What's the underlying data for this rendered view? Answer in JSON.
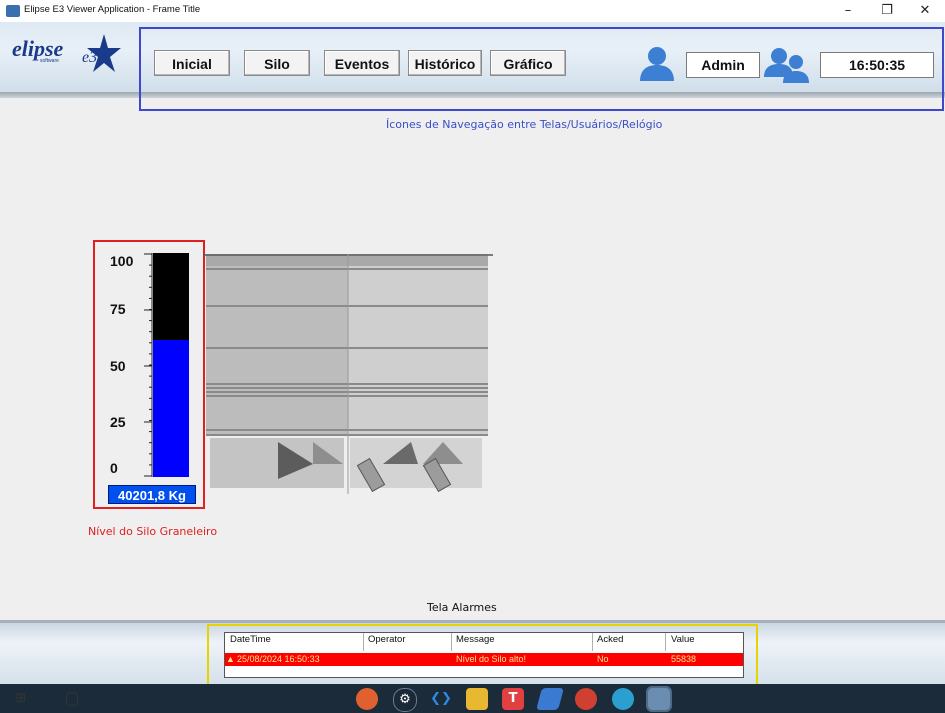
{
  "window": {
    "title": "Elipse E3 Viewer Application - Frame Title",
    "minimize_glyph": "–",
    "restore_glyph": "❐",
    "close_glyph": "✕"
  },
  "logo": {
    "word": "elipse",
    "sub": "software",
    "e3": "e3"
  },
  "nav": {
    "buttons": [
      "Inicial",
      "Silo",
      "Eventos",
      "Histórico",
      "Gráfico"
    ],
    "user": "Admin",
    "clock": "16:50:35",
    "caption": "Ícones de Navegação entre Telas/Usuários/Relógio"
  },
  "level": {
    "ticks": [
      "100",
      "75",
      "50",
      "25",
      "0"
    ],
    "fill_percent": 61,
    "weight": "40201,8 Kg",
    "caption": "Nível do Silo Graneleiro"
  },
  "alarms": {
    "caption": "Tela Alarmes",
    "columns": [
      "DateTime",
      "Operator",
      "Message",
      "Acked",
      "Value"
    ],
    "rows": [
      {
        "datetime": "25/08/2024 16:50:33",
        "operator": "",
        "message": "Nível do Silo alto!",
        "acked": "No",
        "value": "55838"
      }
    ]
  },
  "colors": {
    "nav_outline": "#3f48cc",
    "level_outline": "#e02020",
    "alarm_outline": "#e5d400",
    "caption_blue": "#3a4fc8",
    "caption_red": "#e02020",
    "alarm_row": "#ff0000",
    "level_fill": "#0000ff"
  },
  "taskbar_icons": [
    "chrome-icon",
    "steam-icon",
    "vscode-icon",
    "file-explorer-icon",
    "app-t-icon",
    "app-blue-icon",
    "app-red-icon",
    "app-teal-icon",
    "elipse-viewer-icon"
  ]
}
